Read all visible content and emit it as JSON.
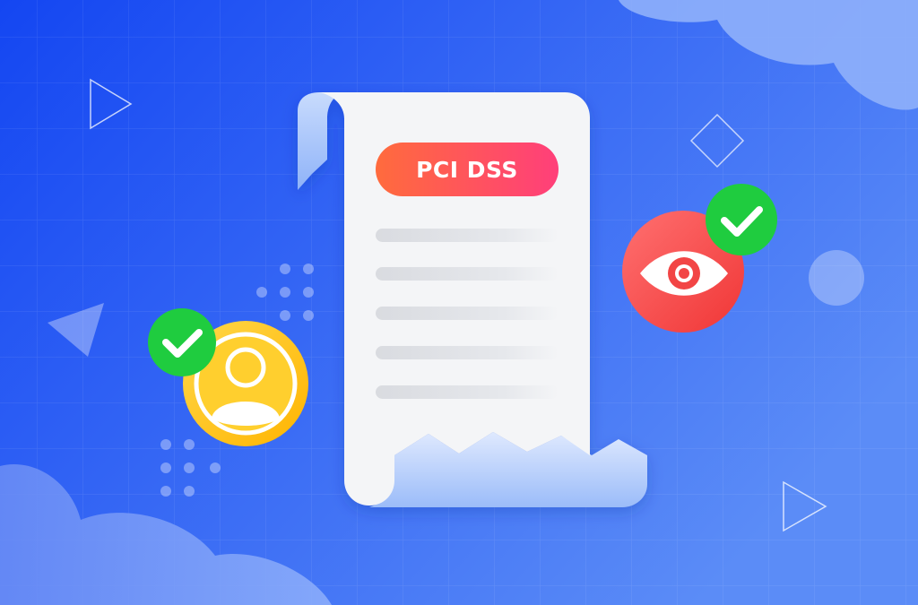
{
  "badge": {
    "label": "PCI DSS"
  },
  "colors": {
    "background_start": "#1446f2",
    "background_end": "#5b8cf7",
    "paper": "#f4f5f7",
    "paper_curl": "#a9c6fb",
    "badge_start": "#ff6b3d",
    "badge_end": "#ff3f7a",
    "check_green": "#1fcc3f",
    "eye_red": "#ff4a4a",
    "user_yellow": "#ffc51a"
  },
  "icons": {
    "document": "document-scroll-icon",
    "user": "user-avatar-icon",
    "eye": "eye-icon",
    "check": "check-icon"
  }
}
